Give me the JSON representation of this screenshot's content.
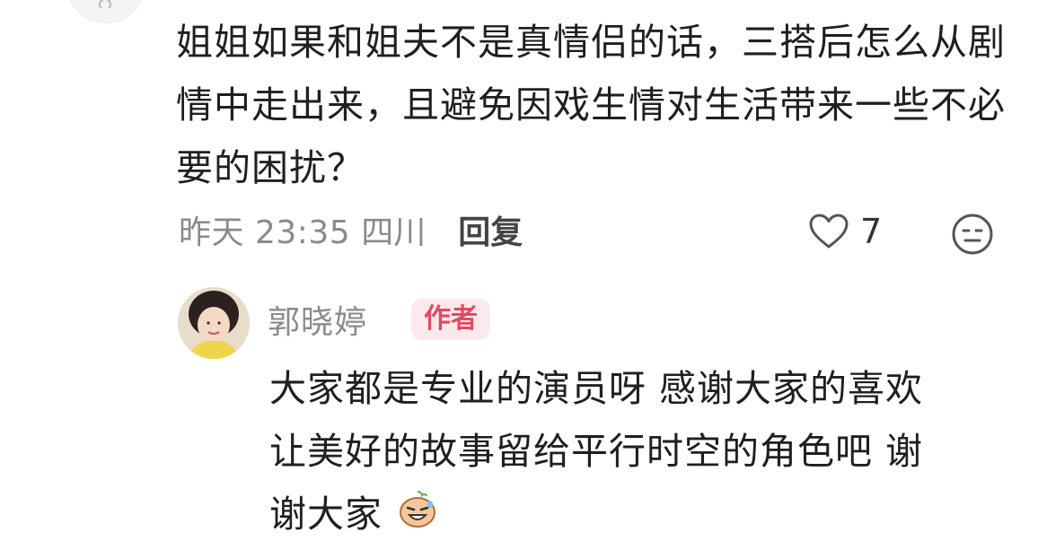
{
  "comment": {
    "text": "姐姐如果和姐夫不是真情侣的话，三搭后怎么从剧情中走出来，且避免因戏生情对生活带来一些不必要的困扰？",
    "time": "昨天 23:35",
    "location": "四川",
    "reply_label": "回复",
    "like_count": "7"
  },
  "reply": {
    "author_name": "郭晓婷",
    "author_badge": "作者",
    "lines": [
      "大家都是专业的演员呀 感谢大家的喜欢",
      "让美好的故事留给平行时空的角色吧 谢",
      "谢大家"
    ],
    "emoji": "grinning-sweat-emoji"
  },
  "colors": {
    "meta_gray": "#8a8a8a",
    "badge_bg": "#fde9ec",
    "badge_text": "#e04a62"
  }
}
